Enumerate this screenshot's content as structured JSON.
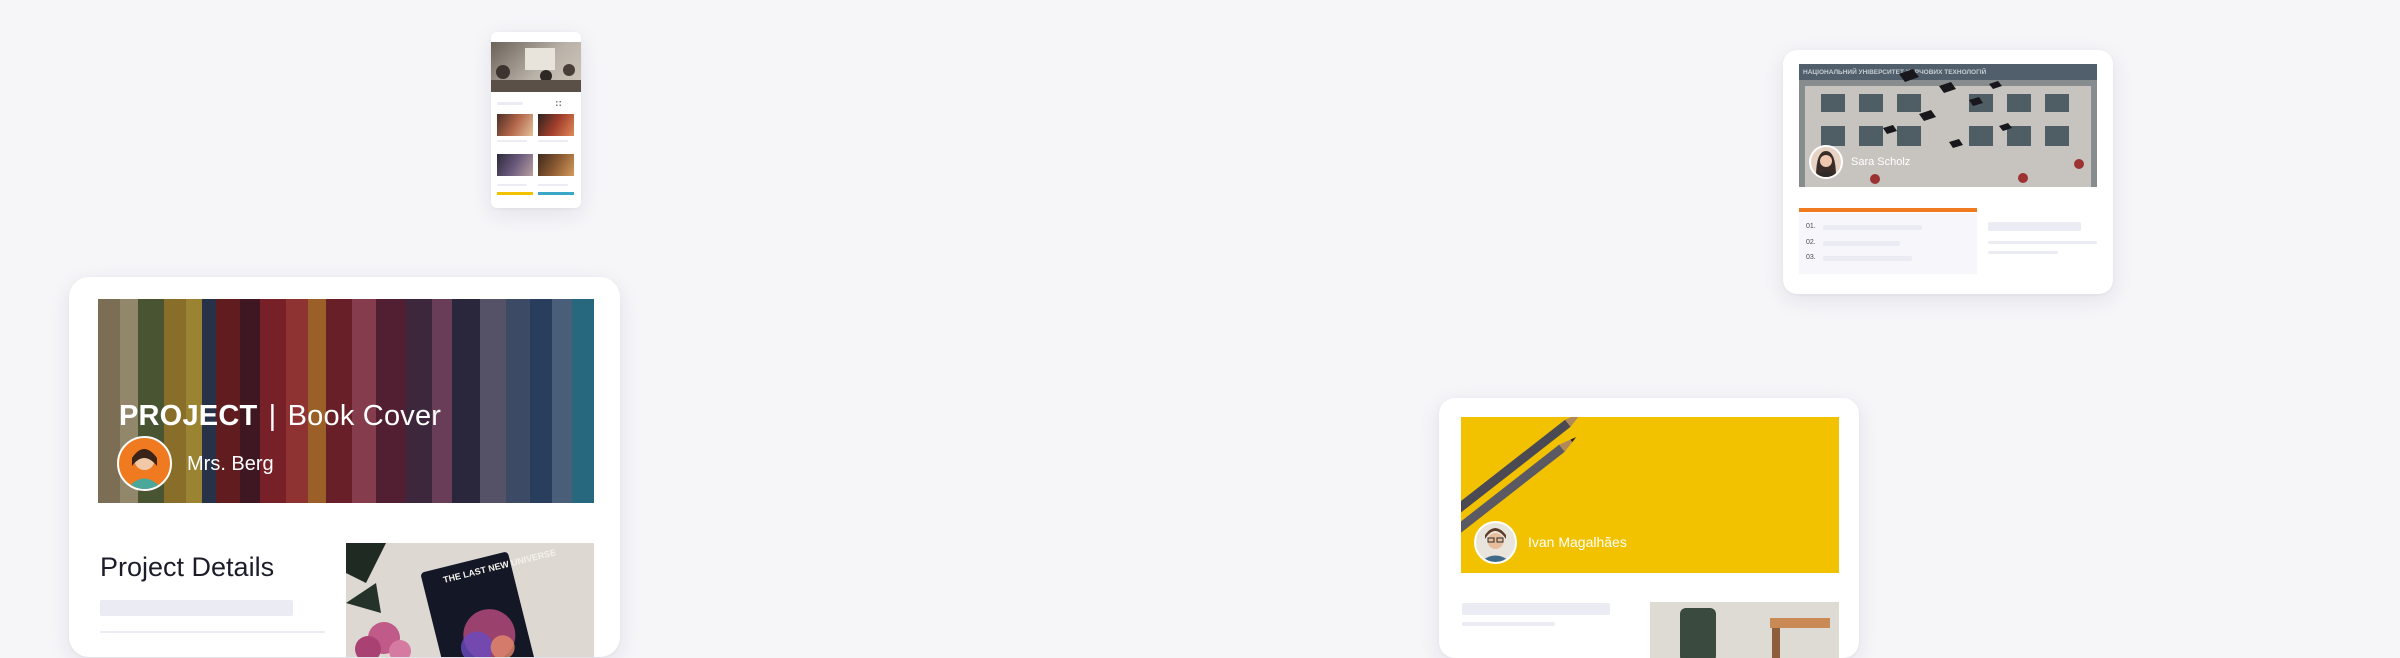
{
  "cards": {
    "book_cover": {
      "title_strong": "PROJECT",
      "title_rest": "Book Cover",
      "author": "Mrs. Berg",
      "section_heading": "Project Details",
      "photo_text": "THE LAST NEW UNIVERSE"
    },
    "graduation": {
      "author": "Sara Scholz",
      "building_sign": "НАЦІОНАЛЬНИЙ УНІВЕРСИТЕТ ХАРЧОВИХ ТЕХНОЛОГІЙ",
      "list_numbers": [
        "01.",
        "02.",
        "03."
      ]
    },
    "pencils": {
      "author": "Ivan Magalhães"
    }
  },
  "colors": {
    "background": "#f6f6f9",
    "accent_orange": "#f07a1f",
    "yellow": "#f2c200",
    "skeleton": "#ebebf3"
  }
}
